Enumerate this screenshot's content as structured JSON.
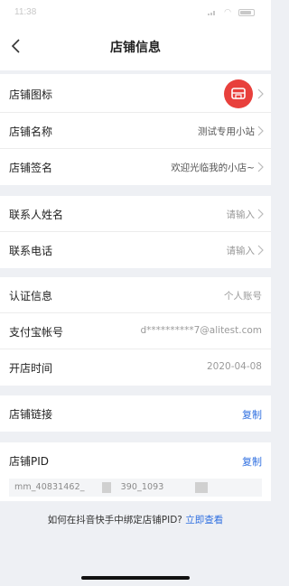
{
  "status_bar": {
    "time": "11:38"
  },
  "header": {
    "title": "店铺信息"
  },
  "shop": {
    "icon_label": "店铺图标",
    "name_label": "店铺名称",
    "name_value": "测试专用小站",
    "slogan_label": "店铺签名",
    "slogan_value": "欢迎光临我的小店~"
  },
  "contact": {
    "name_label": "联系人姓名",
    "name_placeholder": "请输入",
    "phone_label": "联系电话",
    "phone_placeholder": "请输入"
  },
  "account": {
    "cert_label": "认证信息",
    "cert_value": "个人账号",
    "alipay_label": "支付宝帐号",
    "alipay_value": "d**********7@alitest.com",
    "open_label": "开店时间",
    "open_value": "2020-04-08"
  },
  "link": {
    "label": "店铺链接",
    "copy": "复制"
  },
  "pid": {
    "label": "店铺PID",
    "copy": "复制",
    "seg1": "mm_40831462_",
    "seg2": "390_1093",
    "seg3": "1"
  },
  "help": {
    "text": "如何在抖音快手中绑定店铺PID?",
    "link": "立即查看"
  },
  "colors": {
    "accent": "#2f6fe0",
    "shop_icon": "#e8403c",
    "background": "#eef0f4"
  }
}
